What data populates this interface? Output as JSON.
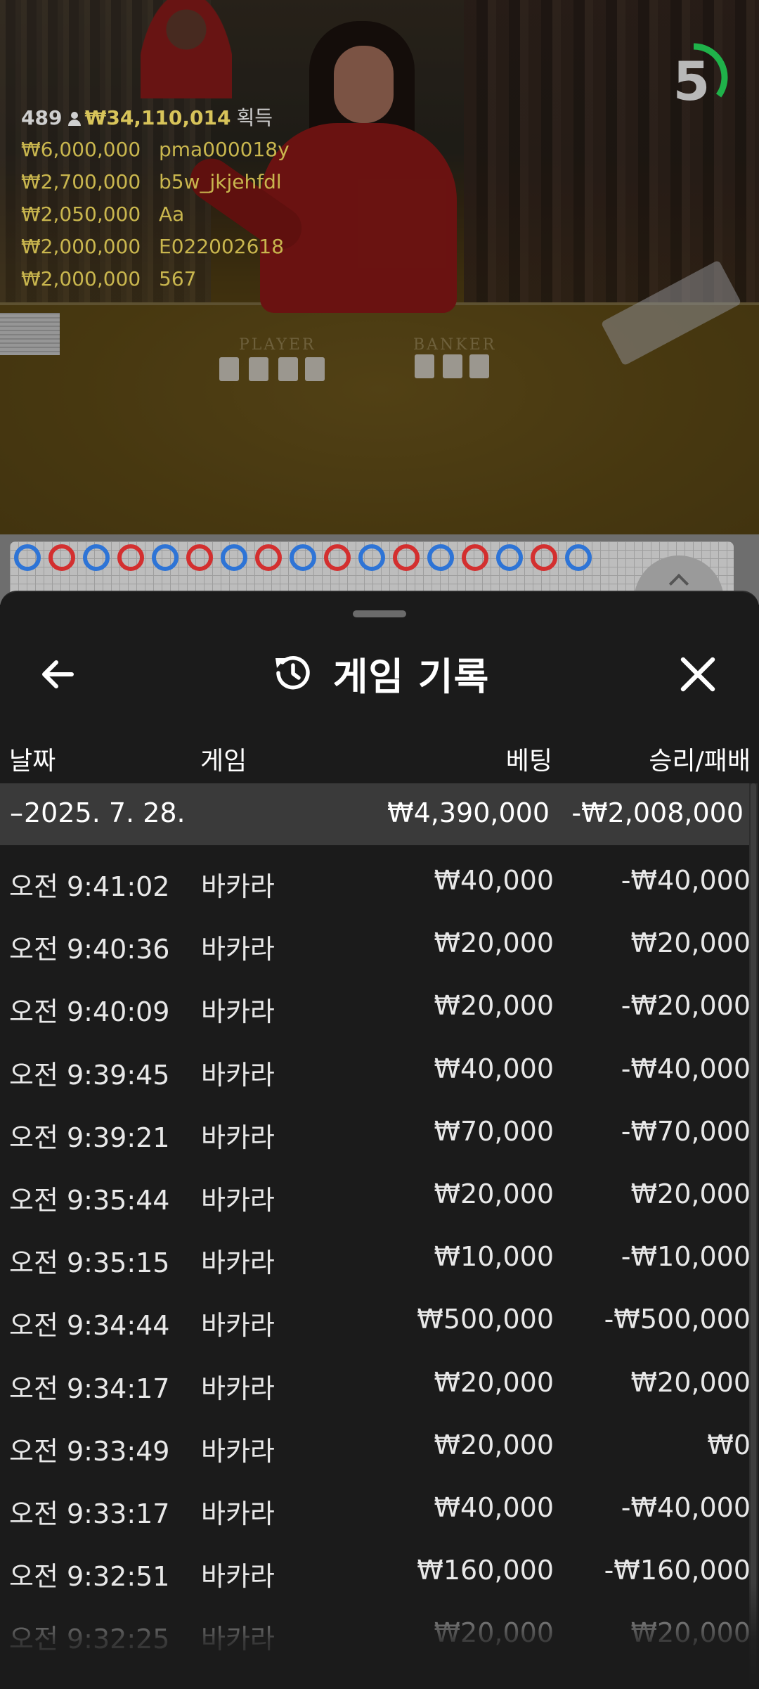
{
  "leaderboard": {
    "player_count": "489",
    "total": "₩34,110,014",
    "total_suffix": "획득",
    "entries": [
      {
        "amount": "₩6,000,000",
        "name": "pma000018y"
      },
      {
        "amount": "₩2,700,000",
        "name": "b5w_jkjehfdl"
      },
      {
        "amount": "₩2,050,000",
        "name": "Aa"
      },
      {
        "amount": "₩2,000,000",
        "name": "E022002618"
      },
      {
        "amount": "₩2,000,000",
        "name": "567"
      }
    ]
  },
  "table_labels": {
    "player": "PLAYER",
    "banker": "BANKER"
  },
  "timer": {
    "value": "5",
    "fraction_remaining": 0.35,
    "color": "#1fb24a"
  },
  "road": {
    "beads": [
      "blue",
      "red",
      "blue",
      "red",
      "blue",
      "red",
      "blue",
      "red",
      "blue",
      "red",
      "blue",
      "red",
      "blue",
      "red",
      "blue",
      "red",
      "blue"
    ],
    "colors": {
      "blue": "#2e74d6",
      "red": "#d32f2f"
    }
  },
  "sheet": {
    "title": "게임 기록",
    "columns": {
      "date": "날짜",
      "game": "게임",
      "bet": "베팅",
      "result": "승리/패배"
    },
    "day": {
      "toggle": "–",
      "date": "2025. 7. 28.",
      "bet": "₩4,390,000",
      "result": "-₩2,008,000"
    },
    "rows": [
      {
        "time": "오전 9:41:02",
        "game": "바카라",
        "bet": "₩40,000",
        "result": "-₩40,000"
      },
      {
        "time": "오전 9:40:36",
        "game": "바카라",
        "bet": "₩20,000",
        "result": "₩20,000"
      },
      {
        "time": "오전 9:40:09",
        "game": "바카라",
        "bet": "₩20,000",
        "result": "-₩20,000"
      },
      {
        "time": "오전 9:39:45",
        "game": "바카라",
        "bet": "₩40,000",
        "result": "-₩40,000"
      },
      {
        "time": "오전 9:39:21",
        "game": "바카라",
        "bet": "₩70,000",
        "result": "-₩70,000"
      },
      {
        "time": "오전 9:35:44",
        "game": "바카라",
        "bet": "₩20,000",
        "result": "₩20,000"
      },
      {
        "time": "오전 9:35:15",
        "game": "바카라",
        "bet": "₩10,000",
        "result": "-₩10,000"
      },
      {
        "time": "오전 9:34:44",
        "game": "바카라",
        "bet": "₩500,000",
        "result": "-₩500,000"
      },
      {
        "time": "오전 9:34:17",
        "game": "바카라",
        "bet": "₩20,000",
        "result": "₩20,000"
      },
      {
        "time": "오전 9:33:49",
        "game": "바카라",
        "bet": "₩20,000",
        "result": "₩0"
      },
      {
        "time": "오전 9:33:17",
        "game": "바카라",
        "bet": "₩40,000",
        "result": "-₩40,000"
      },
      {
        "time": "오전 9:32:51",
        "game": "바카라",
        "bet": "₩160,000",
        "result": "-₩160,000"
      },
      {
        "time": "오전 9:32:25",
        "game": "바카라",
        "bet": "₩20,000",
        "result": "₩20,000"
      }
    ],
    "icons": {
      "back": "arrow-left-icon",
      "history": "history-icon",
      "close": "close-icon"
    }
  }
}
